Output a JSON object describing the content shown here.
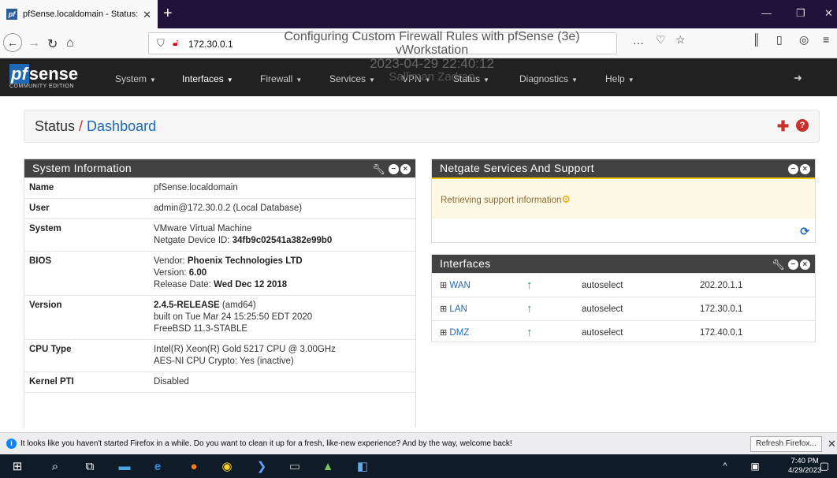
{
  "browser": {
    "tab_title": "pfSense.localdomain - Status: D",
    "tab_favicon": "pf",
    "url": "172.30.0.1",
    "new_tab": "+"
  },
  "watermark": {
    "line1": "Configuring Custom Firewall Rules with pfSense (3e)",
    "line2": "vWorkstation",
    "timestamp": "2023-04-29 22:40:12",
    "name": "Salliman Zadran"
  },
  "pfsense": {
    "logo_text": "sense",
    "logo_pf": "pf",
    "edition": "COMMUNITY EDITION",
    "menu": [
      "System",
      "Interfaces",
      "Firewall",
      "Services",
      "VPN",
      "Status",
      "Diagnostics",
      "Help"
    ]
  },
  "breadcrumb": {
    "root": "Status",
    "sep": " / ",
    "page": "Dashboard"
  },
  "system_info": {
    "title": "System Information",
    "rows": {
      "name_k": "Name",
      "name_v": "pfSense.localdomain",
      "user_k": "User",
      "user_v": "admin@172.30.0.2 (Local Database)",
      "system_k": "System",
      "system_v1": "VMware Virtual Machine",
      "system_v2_label": "Netgate Device ID: ",
      "system_v2_val": "34fb9c02541a382e99b0",
      "bios_k": "BIOS",
      "bios_v1_label": "Vendor: ",
      "bios_v1_val": "Phoenix Technologies LTD",
      "bios_v2_label": "Version: ",
      "bios_v2_val": "6.00",
      "bios_v3_label": "Release Date: ",
      "bios_v3_val": "Wed Dec 12 2018",
      "version_k": "Version",
      "version_v1_bold": "2.4.5-RELEASE",
      "version_v1_rest": " (amd64)",
      "version_v2": "built on Tue Mar 24 15:25:50 EDT 2020",
      "version_v3": "FreeBSD 11.3-STABLE",
      "cpu_k": "CPU Type",
      "cpu_v1": "Intel(R) Xeon(R) Gold 5217 CPU @ 3.00GHz",
      "cpu_v2": "AES-NI CPU Crypto: Yes (inactive)",
      "pti_k": "Kernel PTI",
      "pti_v": "Disabled"
    }
  },
  "netgate": {
    "title": "Netgate Services And Support",
    "retrieving": "Retrieving support information"
  },
  "interfaces": {
    "title": "Interfaces",
    "rows": [
      {
        "name": "WAN",
        "media": "autoselect",
        "ip": "202.20.1.1"
      },
      {
        "name": "LAN",
        "media": "autoselect",
        "ip": "172.30.0.1"
      },
      {
        "name": "DMZ",
        "media": "autoselect",
        "ip": "172.40.0.1"
      }
    ]
  },
  "notification": {
    "message": "It looks like you haven't started Firefox in a while. Do you want to clean it up for a fresh, like-new experience? And by the way, welcome back!",
    "button": "Refresh Firefox..."
  },
  "taskbar": {
    "time": "7:40 PM",
    "date": "4/29/2023"
  },
  "colors": {
    "pf_dark": "#212121",
    "pf_blue": "#1e68b5",
    "panel_head": "#424242",
    "accent_red": "#c9302c"
  }
}
